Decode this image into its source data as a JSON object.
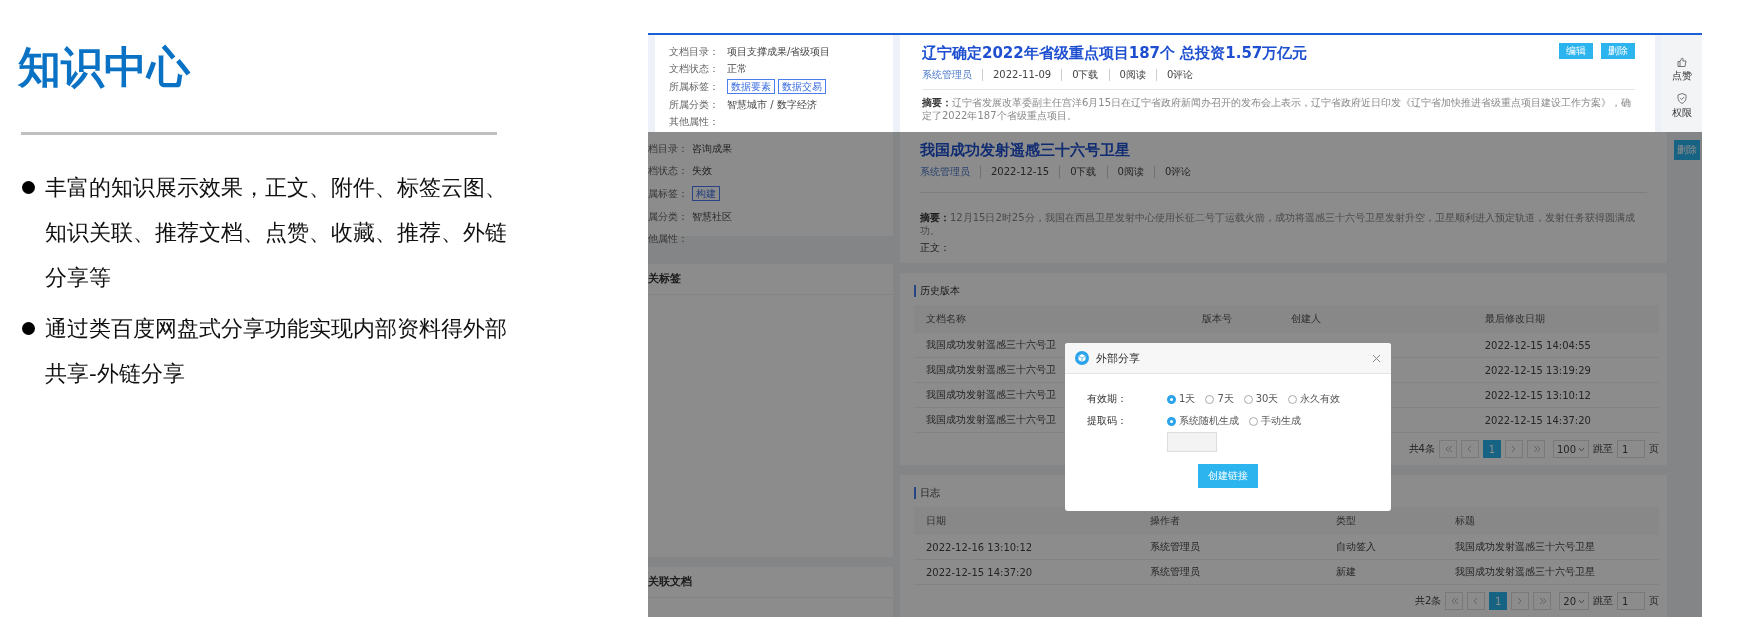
{
  "slide": {
    "title": "知识中心",
    "bullets": [
      "丰富的知识展示效果，正文、附件、标签云图、知识关联、推荐文档、点赞、收藏、推荐、外链分享等",
      "通过类百度网盘式分享功能实现内部资料得外部共享-外链分享"
    ]
  },
  "screenshot": {
    "top_panel": {
      "properties": [
        {
          "label": "文档目录：",
          "value": "项目支撑成果/省级项目"
        },
        {
          "label": "文档状态：",
          "value": "正常"
        },
        {
          "label": "所属标签：",
          "tags": [
            "数据要素",
            "数据交易"
          ]
        },
        {
          "label": "所属分类：",
          "value": "智慧城市 / 数字经济"
        },
        {
          "label": "其他属性："
        }
      ],
      "title": "辽宁确定2022年省级重点项目187个 总投资1.57万亿元",
      "author": "系统管理员",
      "stats": [
        "2022-11-09",
        "0下载",
        "0阅读",
        "0评论"
      ],
      "abstract_label": "摘要：",
      "abstract": "辽宁省发展改革委副主任宫洋6月15日在辽宁省政府新闻办召开的发布会上表示，辽宁省政府近日印发《辽宁省加快推进省级重点项目建设工作方案》，确定了2022年187个省级重点项目。",
      "buttons": [
        "编辑",
        "删除"
      ],
      "side_actions": [
        {
          "kind": "like",
          "label": "点赞"
        },
        {
          "kind": "permission",
          "label": "权限"
        }
      ]
    },
    "document": {
      "properties": [
        {
          "label": "档目录：",
          "value": "咨询成果"
        },
        {
          "label": "档状态：",
          "value": "失效"
        },
        {
          "label": "属标签：",
          "tags": [
            "构建"
          ]
        },
        {
          "label": "属分类：",
          "value": "智慧社区"
        },
        {
          "label": "他属性："
        }
      ],
      "tags_panel_title": "关标签",
      "related_panel_title": "关联文档",
      "title": "我国成功发射遥感三十六号卫星",
      "author": "系统管理员",
      "stats": [
        "2022-12-15",
        "0下载",
        "0阅读",
        "0评论"
      ],
      "abstract_label": "摘要：",
      "abstract": "12月15日2时25分，我国在西昌卫星发射中心使用长征二号丁运载火箭，成功将遥感三十六号卫星发射升空，卫星顺利进入预定轨道，发射任务获得圆满成功。",
      "body_label": "正文：",
      "delete_button": "删除",
      "history": {
        "title": "历史版本",
        "columns": [
          "文档名称",
          "版本号",
          "创建人",
          "最后修改日期"
        ],
        "rows": [
          {
            "name": "我国成功发射遥感三十六号卫",
            "modified": "2022-12-15 14:04:55"
          },
          {
            "name": "我国成功发射遥感三十六号卫",
            "modified": "2022-12-15 13:19:29"
          },
          {
            "name": "我国成功发射遥感三十六号卫",
            "modified": "2022-12-15 13:10:12"
          },
          {
            "name": "我国成功发射遥感三十六号卫",
            "modified": "2022-12-15 14:37:20"
          }
        ],
        "pagination": {
          "total": "共4条",
          "pages": [
            {
              "label": "1",
              "selected": true
            }
          ],
          "page_size": "100",
          "jump_label": "跳至",
          "jump_value": "1",
          "page_unit": "页"
        }
      },
      "log": {
        "title": "日志",
        "columns": [
          "日期",
          "操作者",
          "类型",
          "标题"
        ],
        "rows": [
          [
            "2022-12-16 13:10:12",
            "系统管理员",
            "自动签入",
            "我国成功发射遥感三十六号卫星"
          ],
          [
            "2022-12-15 14:37:20",
            "系统管理员",
            "新建",
            "我国成功发射遥感三十六号卫星"
          ]
        ],
        "pagination": {
          "total": "共2条",
          "pages": [
            {
              "label": "1",
              "selected": true
            }
          ],
          "page_size": "20",
          "jump_label": "跳至",
          "jump_value": "1",
          "page_unit": "页"
        }
      }
    },
    "dialog": {
      "title": "外部分享",
      "validity_label": "有效期：",
      "validity_options": [
        {
          "label": "1天",
          "selected": true
        },
        {
          "label": "7天",
          "selected": false
        },
        {
          "label": "30天",
          "selected": false
        },
        {
          "label": "永久有效",
          "selected": false
        }
      ],
      "code_label": "提取码：",
      "code_options": [
        {
          "label": "系统随机生成",
          "selected": true
        },
        {
          "label": "手动生成",
          "selected": false
        }
      ],
      "create_button": "创建链接"
    }
  }
}
